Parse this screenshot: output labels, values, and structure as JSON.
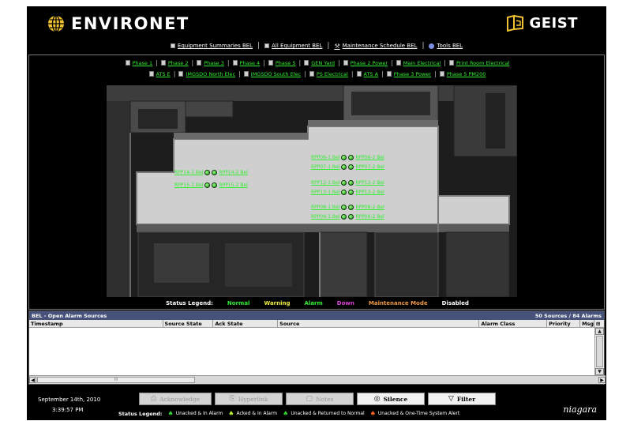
{
  "header": {
    "brand": "ENVIRONET",
    "partner": "GEIST"
  },
  "topnav": [
    {
      "label": "Equipment Summaries BEL",
      "icon": "square-icon"
    },
    {
      "label": "All Equipment BEL",
      "icon": "square-icon"
    },
    {
      "label": "Maintenance Schedule BEL",
      "icon": "wrench-icon"
    },
    {
      "label": "Tools BEL",
      "icon": "info-icon"
    }
  ],
  "tabs_row1": [
    "Phase 1",
    "Phase 2",
    "Phase 3",
    "Phase 4",
    "Phase 5",
    "GEN Yard",
    "Phase 2 Power",
    "Main Electrical",
    "Print Room Electrical"
  ],
  "tabs_row2": [
    "ATS E",
    "IMGSDO North Elec",
    "IMGSDO South Elec",
    "PS Electrical",
    "ATS A",
    "Phase 3 Power",
    "Phase 5 PM200"
  ],
  "equipment": [
    {
      "left": "RPP14-1 Bel",
      "right": "RPP14-2 Bel"
    },
    {
      "left": "RPP15-1 Bel",
      "right": "RPP15-2 Bel"
    },
    {
      "left": "RPP06-1 Bel",
      "right": "RPP06-2 Bel"
    },
    {
      "left": "RPP07-1 Bel",
      "right": "RPP07-2 Bel"
    },
    {
      "left": "RPP12-1 Bel",
      "right": "RPP12-2 Bel"
    },
    {
      "left": "RPP13-1 Bel",
      "right": "RPP13-2 Bel"
    },
    {
      "left": "RPP08-1 Bel",
      "right": "RPP08-2 Bel"
    },
    {
      "left": "RPP09-1 Bel",
      "right": "RPP09-2 Bel"
    }
  ],
  "legend": {
    "title": "Status Legend:",
    "items": [
      {
        "label": "Normal",
        "color": "#33ee33"
      },
      {
        "label": "Warning",
        "color": "#eeee44"
      },
      {
        "label": "Alarm",
        "color": "#33ee33"
      },
      {
        "label": "Down",
        "color": "#dd44dd"
      },
      {
        "label": "Maintenance Mode",
        "color": "#ee9944"
      },
      {
        "label": "Disabled",
        "color": "#ffffff"
      }
    ]
  },
  "alarm": {
    "title": "BEL - Open Alarm Sources",
    "counts": "50 Sources / 84 Alarms",
    "columns": [
      "Timestamp",
      "Source State",
      "Ack State",
      "Source",
      "Alarm Class",
      "Priority",
      "Msg"
    ],
    "scroll_label": "III"
  },
  "bottom": {
    "date": "September 14th, 2010",
    "time": "3:39:57 PM",
    "buttons": [
      {
        "label": "Acknowledge",
        "icon": "ack-icon",
        "glyph": "⎙",
        "enabled": false
      },
      {
        "label": "Hyperlink",
        "icon": "hyperlink-icon",
        "glyph": "⎘",
        "enabled": false
      },
      {
        "label": "Notes",
        "icon": "notes-icon",
        "glyph": "▢",
        "enabled": false
      },
      {
        "label": "Silence",
        "icon": "silence-icon",
        "glyph": "◎",
        "enabled": true
      },
      {
        "label": "Filter",
        "icon": "filter-icon",
        "glyph": "▽",
        "enabled": true
      }
    ],
    "status_legend_title": "Status Legend:",
    "status_items": [
      {
        "label": "Unacked & In Alarm",
        "color": "#33cc33"
      },
      {
        "label": "Acked & In Alarm",
        "color": "#bbee33"
      },
      {
        "label": "Unacked & Returned to Normal",
        "color": "#33cc33"
      },
      {
        "label": "Unacked & One-Time System Alert",
        "color": "#ff6622"
      }
    ],
    "vendor": "niagara"
  }
}
